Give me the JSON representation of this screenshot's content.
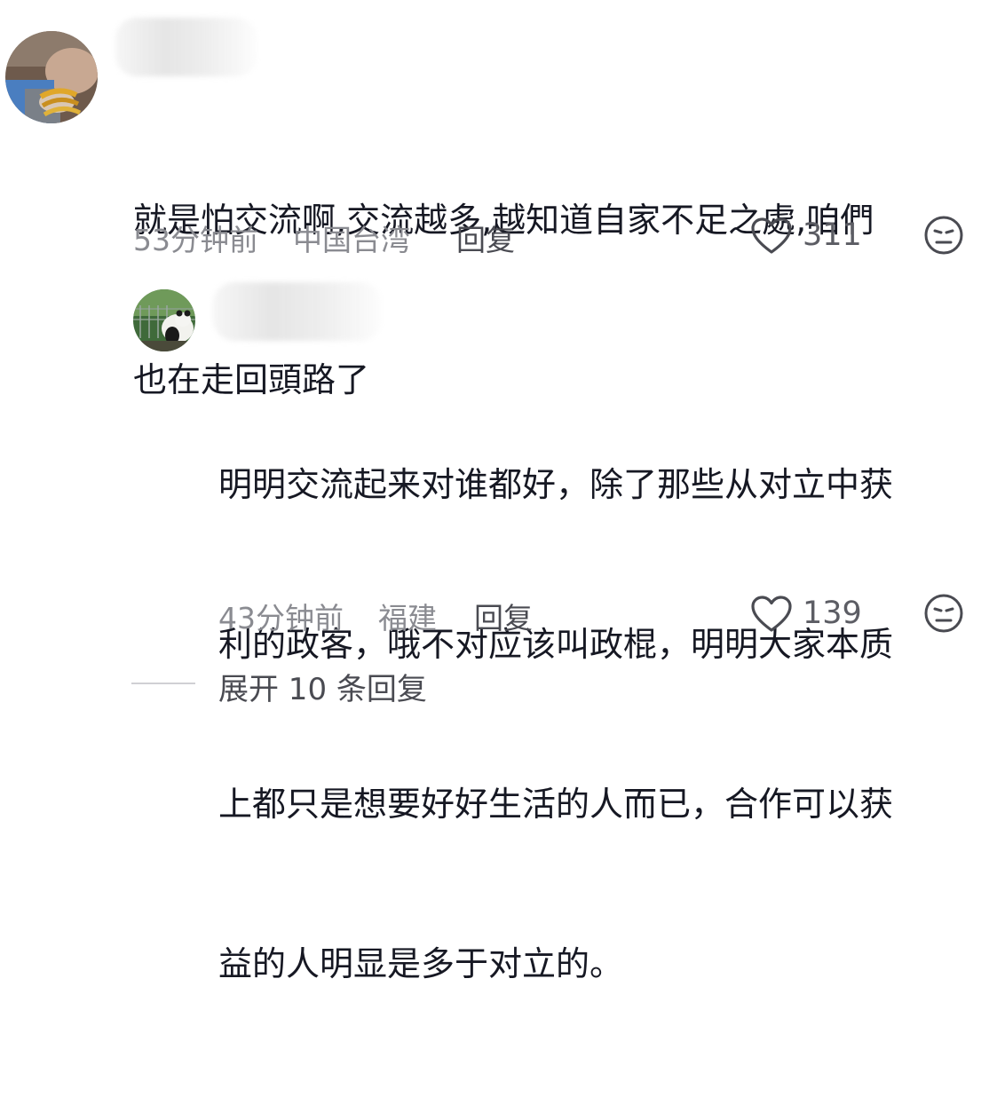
{
  "comments": [
    {
      "text_lines": [
        "就是怕交流啊,交流越多,越知道自家不足之處,咱們",
        "也在走回頭路了"
      ],
      "time": "53分钟前",
      "location": "中国台湾",
      "reply_label": "回复",
      "likes": "311",
      "like_icon": "heart-outline-icon",
      "react_icon": "neutral-face-icon"
    },
    {
      "text_lines": [
        "明明交流起来对谁都好，除了那些从对立中获",
        "利的政客，哦不对应该叫政棍，明明大家本质",
        "上都只是想要好好生活的人而已，合作可以获",
        "益的人明显是多于对立的。"
      ],
      "time": "43分钟前",
      "location": "福建",
      "reply_label": "回复",
      "likes": "139",
      "like_icon": "heart-outline-icon",
      "react_icon": "neutral-face-icon"
    }
  ],
  "expand_replies": {
    "label": "展开 10 条回复"
  },
  "colors": {
    "text": "#161823",
    "meta": "#8a8b91",
    "action": "#4a4b52"
  }
}
